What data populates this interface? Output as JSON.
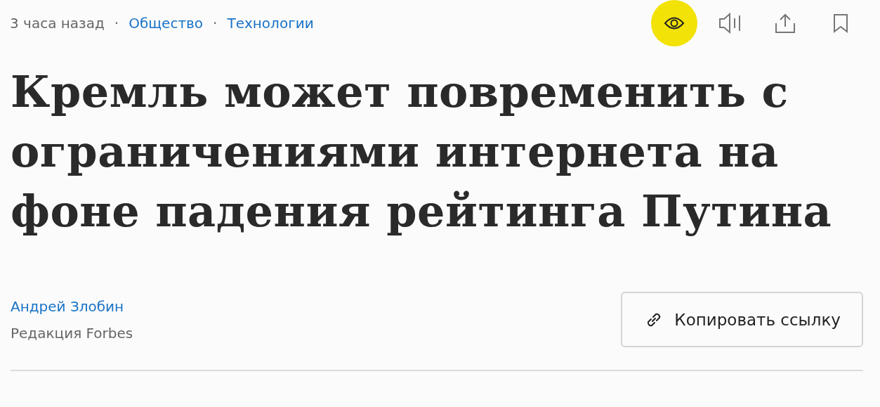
{
  "meta": {
    "time": "3 часа назад",
    "separator": "·",
    "tags": [
      {
        "label": "Общество"
      },
      {
        "label": "Технологии"
      }
    ]
  },
  "toolbar": [
    {
      "kind": "eye",
      "active": true
    },
    {
      "kind": "audio",
      "active": false
    },
    {
      "kind": "share",
      "active": false
    },
    {
      "kind": "bookmark",
      "active": false
    }
  ],
  "headline": "Кремль может повременить с ограничениями интернета на фоне падения рейтинга Путина",
  "author": {
    "name": "Андрей Злобин",
    "desk": "Редакция Forbes"
  },
  "copy_button": {
    "label": "Копировать ссылку"
  }
}
